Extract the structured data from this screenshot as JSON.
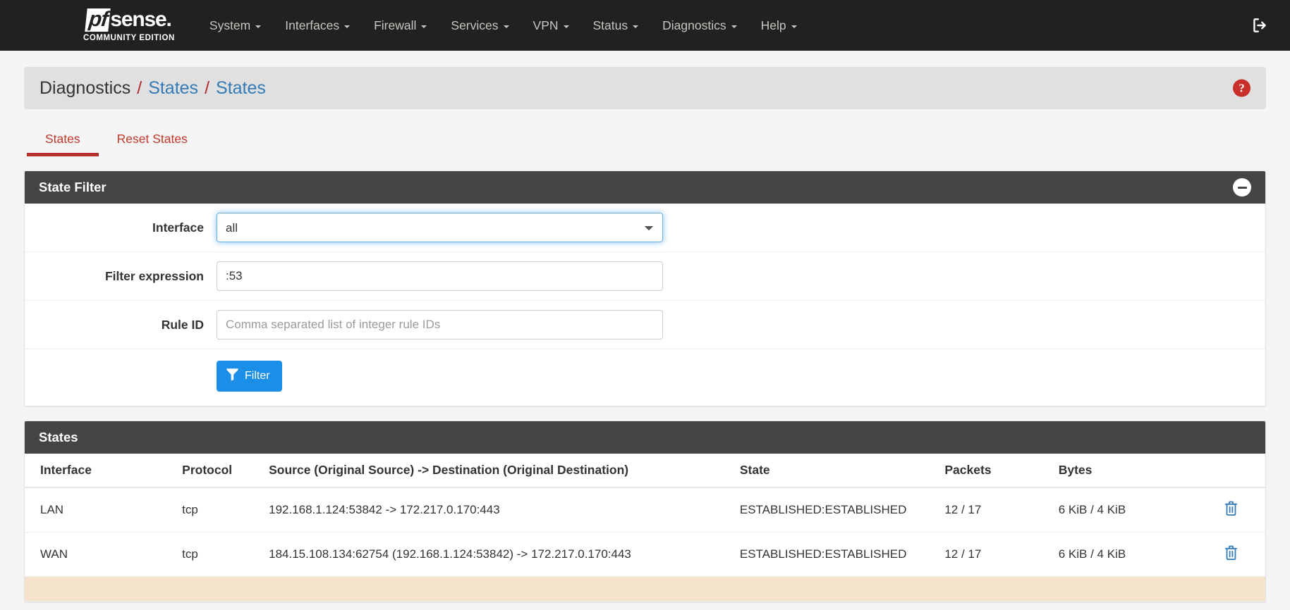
{
  "navbar": {
    "brand": {
      "pf": "pf",
      "sense": "sense",
      "subtitle": "COMMUNITY EDITION"
    },
    "items": [
      {
        "label": "System",
        "icon": "chevron-down-icon"
      },
      {
        "label": "Interfaces",
        "icon": "chevron-down-icon"
      },
      {
        "label": "Firewall",
        "icon": "chevron-down-icon"
      },
      {
        "label": "Services",
        "icon": "chevron-down-icon"
      },
      {
        "label": "VPN",
        "icon": "chevron-down-icon"
      },
      {
        "label": "Status",
        "icon": "chevron-down-icon"
      },
      {
        "label": "Diagnostics",
        "icon": "chevron-down-icon"
      },
      {
        "label": "Help",
        "icon": "chevron-down-icon"
      }
    ],
    "logout_icon": "logout-icon"
  },
  "breadcrumb": {
    "items": [
      "Diagnostics",
      "States",
      "States"
    ],
    "separator": "/",
    "help_icon": "help-circle-icon",
    "help_glyph": "?"
  },
  "tabs": [
    {
      "label": "States",
      "active": true
    },
    {
      "label": "Reset States",
      "active": false
    }
  ],
  "state_filter": {
    "title": "State Filter",
    "collapse_icon": "minus-circle-icon",
    "interface": {
      "label": "Interface",
      "value": "all",
      "options": [
        "all"
      ]
    },
    "filter_expression": {
      "label": "Filter expression",
      "value": ":53",
      "placeholder": ""
    },
    "rule_id": {
      "label": "Rule ID",
      "value": "",
      "placeholder": "Comma separated list of integer rule IDs"
    },
    "filter_button": {
      "label": "Filter",
      "icon": "funnel-icon"
    }
  },
  "states_panel": {
    "title": "States",
    "columns": [
      "Interface",
      "Protocol",
      "Source (Original Source) -> Destination (Original Destination)",
      "State",
      "Packets",
      "Bytes",
      ""
    ],
    "rows": [
      {
        "interface": "LAN",
        "protocol": "tcp",
        "source_dest": "192.168.1.124:53842 -> 172.217.0.170:443",
        "state": "ESTABLISHED:ESTABLISHED",
        "packets": "12 / 17",
        "bytes": "6 KiB / 4 KiB",
        "delete_icon": "trash-icon",
        "highlighted": false
      },
      {
        "interface": "WAN",
        "protocol": "tcp",
        "source_dest": "184.15.108.134:62754 (192.168.1.124:53842) -> 172.217.0.170:443",
        "state": "ESTABLISHED:ESTABLISHED",
        "packets": "12 / 17",
        "bytes": "6 KiB / 4 KiB",
        "delete_icon": "trash-icon",
        "highlighted": false
      },
      {
        "interface": "",
        "protocol": "",
        "source_dest": "",
        "state": "",
        "packets": "",
        "bytes": "",
        "delete_icon": "trash-icon",
        "highlighted": true
      }
    ]
  },
  "colors": {
    "navbar_bg": "#212121",
    "panel_heading_bg": "#444444",
    "breadcrumb_bg": "#e0e0e0",
    "tab_red": "#c0392b",
    "link_blue": "#337ab7",
    "button_blue": "#1b8fe8",
    "help_red": "#c9302c",
    "trash_blue": "#337ab7",
    "row_highlight": "#f6e3cd"
  }
}
